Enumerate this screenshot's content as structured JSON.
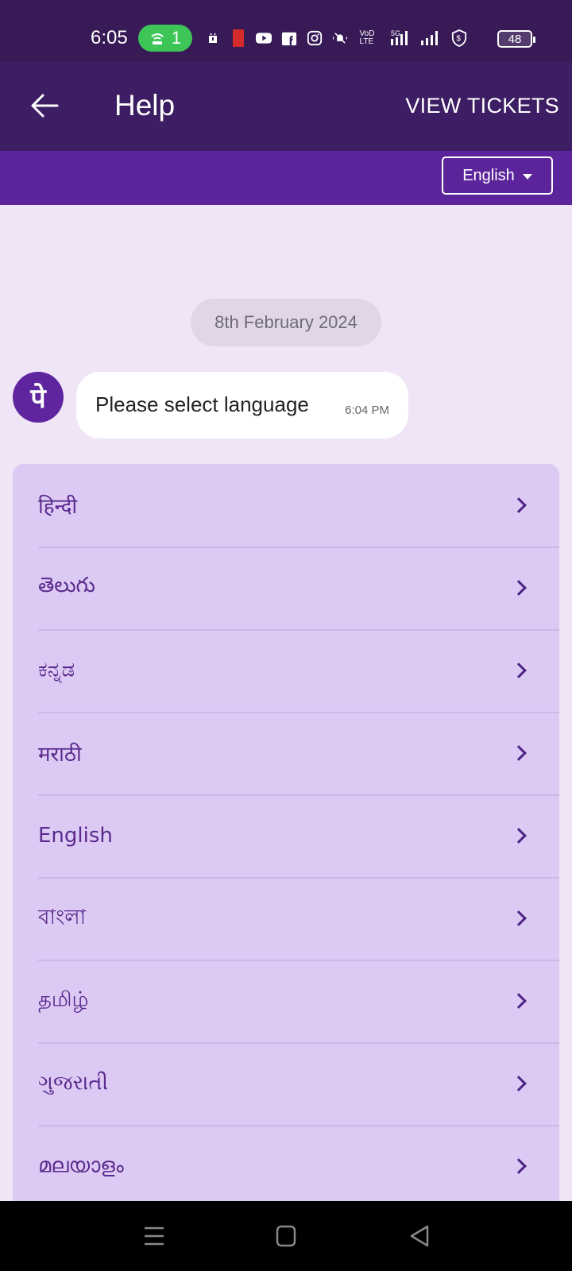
{
  "status_bar": {
    "time": "6:05",
    "hotspot_count": "1",
    "battery": "48",
    "icons": [
      "hotspot-icon",
      "notification-icon",
      "red-app-icon",
      "youtube-icon",
      "facebook-icon",
      "instagram-icon",
      "mute-icon",
      "volte-icon",
      "5g-signal-icon",
      "signal-icon",
      "shield-dollar-icon",
      "battery-icon"
    ],
    "network_label": "5G"
  },
  "app_bar": {
    "title": "Help",
    "action_label": "VIEW TICKETS"
  },
  "language_selector": {
    "selected": "English"
  },
  "chat": {
    "date": "8th February 2024",
    "avatar_glyph": "पे",
    "message": "Please select language",
    "message_time": "6:04 PM"
  },
  "languages": [
    {
      "label": "हिन्दी"
    },
    {
      "label": "తెలుగు"
    },
    {
      "label": "ಕನ್ನಡ"
    },
    {
      "label": "मराठी"
    },
    {
      "label": "English"
    },
    {
      "label": "বাংলা"
    },
    {
      "label": "தமிழ்"
    },
    {
      "label": "ગુજરાતી"
    },
    {
      "label": "മലയാളം"
    }
  ],
  "colors": {
    "status_bar": "#371a56",
    "app_bar": "#3d1d63",
    "brand_purple": "#5f259f",
    "card_bg": "#dccaf5",
    "page_bg": "#f0e4f7"
  }
}
